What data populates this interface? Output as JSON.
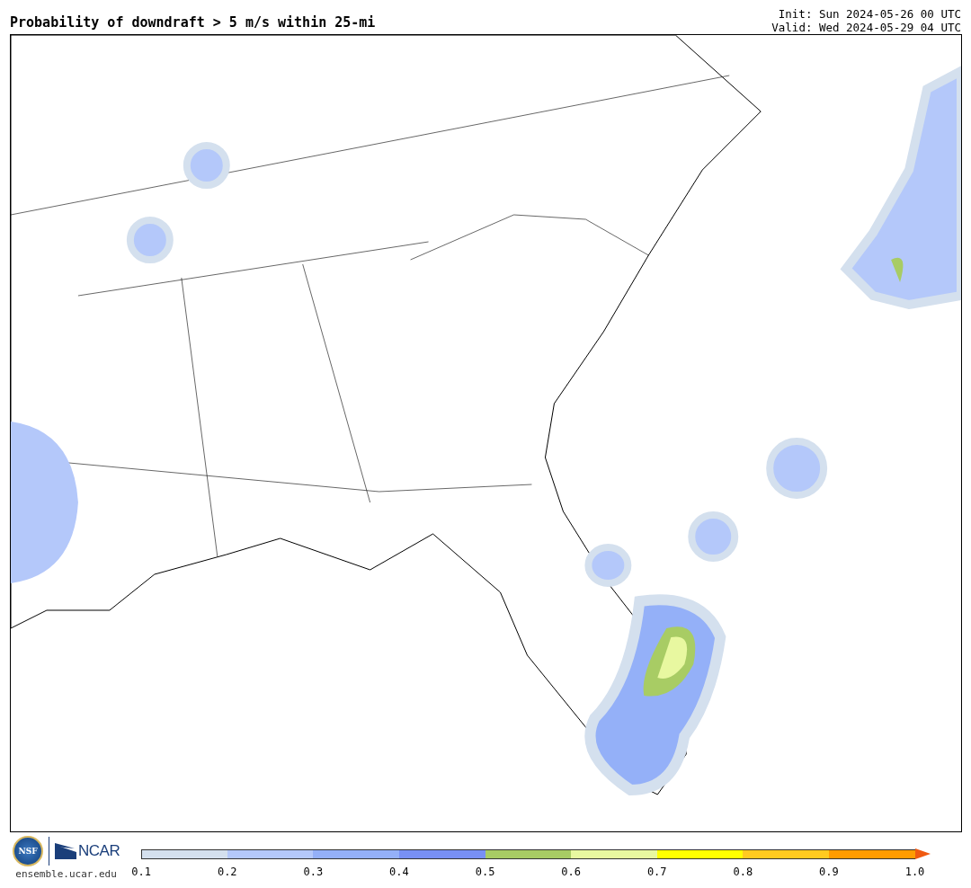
{
  "title": "Probability of downdraft > 5 m/s within 25-mi",
  "run_info": [
    "Init: Sun 2024-05-26 00 UTC",
    "Valid: Wed 2024-05-29 04 UTC"
  ],
  "footer": {
    "nsf_logo": "NSF",
    "ncar_logo": "NCAR",
    "site": "ensemble.ucar.edu"
  },
  "colorbar": {
    "segments": [
      {
        "color": "#d4e0ee"
      },
      {
        "color": "#b4c8fa"
      },
      {
        "color": "#94b0f8"
      },
      {
        "color": "#7890f4"
      },
      {
        "color": "#a8cc64"
      },
      {
        "color": "#e8f8a0"
      },
      {
        "color": "#ffff00"
      },
      {
        "color": "#ffca20"
      },
      {
        "color": "#ff9c00"
      },
      {
        "color": "#f05a10",
        "kind": "arrow"
      }
    ],
    "ticks": [
      "0.1",
      "0.2",
      "0.3",
      "0.4",
      "0.5",
      "0.6",
      "0.7",
      "0.8",
      "0.9",
      "1.0"
    ]
  }
}
